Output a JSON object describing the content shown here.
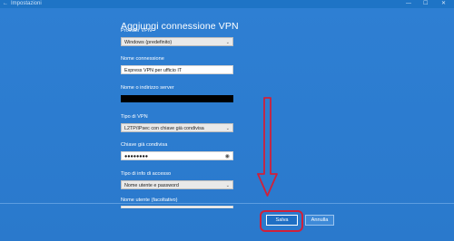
{
  "window": {
    "title": "Impostazioni",
    "back_icon": "back-arrow-icon",
    "controls": {
      "minimize": "—",
      "maximize": "☐",
      "close": "✕"
    }
  },
  "dialog": {
    "title": "Aggiungi connessione VPN",
    "fields": {
      "provider": {
        "label": "Provider VPN",
        "value": "Windows (predefinito)"
      },
      "connection_name": {
        "label": "Nome connessione",
        "value": "Express VPN per ufficio IT"
      },
      "server": {
        "label": "Nome o indirizzo server",
        "value": ""
      },
      "vpn_type": {
        "label": "Tipo di VPN",
        "value": "L2TP/IPsec con chiave già condivisa"
      },
      "preshared_key": {
        "label": "Chiave già condivisa",
        "value": "●●●●●●●●"
      },
      "signin_type": {
        "label": "Tipo di info di accesso",
        "value": "Nome utente e password"
      },
      "username": {
        "label": "Nome utente (facoltativo)",
        "value": ""
      }
    },
    "buttons": {
      "save": "Salva",
      "cancel": "Annulla"
    }
  },
  "colors": {
    "accent": "#2e7fd3",
    "annotation": "#d0203a"
  }
}
